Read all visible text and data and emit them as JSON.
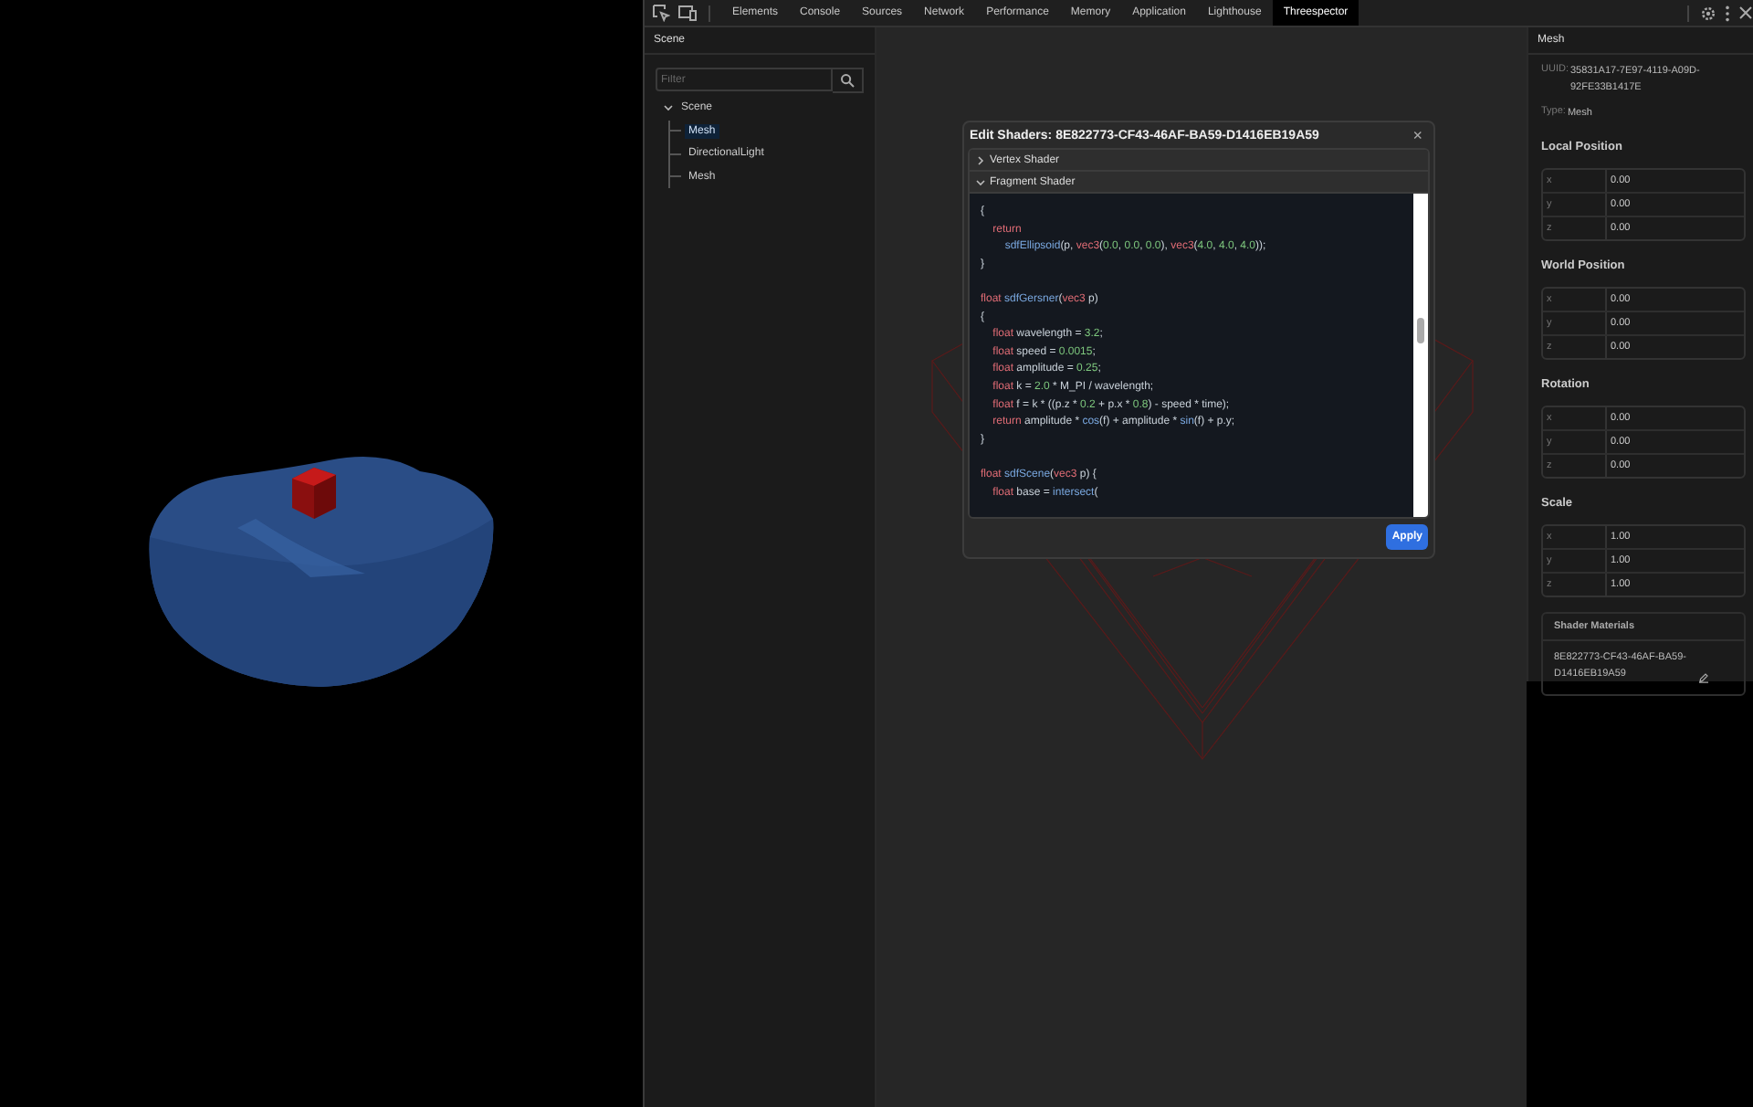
{
  "devtools": {
    "tabs": [
      {
        "label": "Elements",
        "selected": false
      },
      {
        "label": "Console",
        "selected": false
      },
      {
        "label": "Sources",
        "selected": false
      },
      {
        "label": "Network",
        "selected": false
      },
      {
        "label": "Performance",
        "selected": false
      },
      {
        "label": "Memory",
        "selected": false
      },
      {
        "label": "Application",
        "selected": false
      },
      {
        "label": "Lighthouse",
        "selected": false
      },
      {
        "label": "Threespector",
        "selected": true
      }
    ]
  },
  "scene_panel": {
    "title": "Scene",
    "filter": {
      "placeholder": "Filter"
    },
    "tree": [
      {
        "label": "Scene",
        "expanded": true,
        "selected": false,
        "children": [
          {
            "label": "Mesh",
            "selected": true
          },
          {
            "label": "DirectionalLight",
            "selected": false
          },
          {
            "label": "Mesh",
            "selected": false
          }
        ]
      }
    ]
  },
  "dialog": {
    "title": "Edit Shaders: 8E822773-CF43-46AF-BA59-D1416EB19A59",
    "close": "×",
    "sections": [
      {
        "label": "Vertex Shader",
        "expanded": false
      },
      {
        "label": "Fragment Shader",
        "expanded": true
      }
    ],
    "code": [
      {
        "kind": "code",
        "tokens": [
          {
            "text": "{",
            "kind": "plain"
          }
        ]
      },
      {
        "kind": "code",
        "tokens": [
          {
            "text": "    return",
            "kind": "kw"
          }
        ]
      },
      {
        "kind": "code",
        "tokens": [
          {
            "text": "        sdfEllipsoid",
            "kind": "fn"
          },
          {
            "text": "(p, ",
            "kind": "plain"
          },
          {
            "text": "vec3",
            "kind": "kw"
          },
          {
            "text": "(",
            "kind": "plain"
          },
          {
            "text": "0.0",
            "kind": "num"
          },
          {
            "text": ", ",
            "kind": "plain"
          },
          {
            "text": "0.0",
            "kind": "num"
          },
          {
            "text": ", ",
            "kind": "plain"
          },
          {
            "text": "0.0",
            "kind": "num"
          },
          {
            "text": "), ",
            "kind": "plain"
          },
          {
            "text": "vec3",
            "kind": "kw"
          },
          {
            "text": "(",
            "kind": "plain"
          },
          {
            "text": "4.0",
            "kind": "num"
          },
          {
            "text": ", ",
            "kind": "plain"
          },
          {
            "text": "4.0",
            "kind": "num"
          },
          {
            "text": ", ",
            "kind": "plain"
          },
          {
            "text": "4.0",
            "kind": "num"
          },
          {
            "text": "));",
            "kind": "plain"
          }
        ]
      },
      {
        "kind": "code",
        "tokens": [
          {
            "text": "}",
            "kind": "plain"
          }
        ]
      },
      {
        "kind": "blank"
      },
      {
        "kind": "code",
        "tokens": [
          {
            "text": "float",
            "kind": "kw"
          },
          {
            "text": " sdfGersner",
            "kind": "fn"
          },
          {
            "text": "(",
            "kind": "plain"
          },
          {
            "text": "vec3",
            "kind": "kw"
          },
          {
            "text": " p)",
            "kind": "plain"
          }
        ]
      },
      {
        "kind": "code",
        "tokens": [
          {
            "text": "{",
            "kind": "plain"
          }
        ]
      },
      {
        "kind": "code",
        "tokens": [
          {
            "text": "    float",
            "kind": "kw"
          },
          {
            "text": " wavelength = ",
            "kind": "plain"
          },
          {
            "text": "3.2",
            "kind": "num"
          },
          {
            "text": ";",
            "kind": "plain"
          }
        ]
      },
      {
        "kind": "code",
        "tokens": [
          {
            "text": "    float",
            "kind": "kw"
          },
          {
            "text": " speed = ",
            "kind": "plain"
          },
          {
            "text": "0.0015",
            "kind": "num"
          },
          {
            "text": ";",
            "kind": "plain"
          }
        ]
      },
      {
        "kind": "code",
        "tokens": [
          {
            "text": "    float",
            "kind": "kw"
          },
          {
            "text": " amplitude = ",
            "kind": "plain"
          },
          {
            "text": "0.25",
            "kind": "num"
          },
          {
            "text": ";",
            "kind": "plain"
          }
        ]
      },
      {
        "kind": "code",
        "tokens": [
          {
            "text": "    float",
            "kind": "kw"
          },
          {
            "text": " k = ",
            "kind": "plain"
          },
          {
            "text": "2.0",
            "kind": "num"
          },
          {
            "text": " * M_PI / wavelength;",
            "kind": "plain"
          }
        ]
      },
      {
        "kind": "code",
        "tokens": [
          {
            "text": "    float",
            "kind": "kw"
          },
          {
            "text": " f = k * ((p.z * ",
            "kind": "plain"
          },
          {
            "text": "0.2",
            "kind": "num"
          },
          {
            "text": " + p.x * ",
            "kind": "plain"
          },
          {
            "text": "0.8",
            "kind": "num"
          },
          {
            "text": ") - speed * time);",
            "kind": "plain"
          }
        ]
      },
      {
        "kind": "code",
        "tokens": [
          {
            "text": "    return",
            "kind": "kw"
          },
          {
            "text": " amplitude * ",
            "kind": "plain"
          },
          {
            "text": "cos",
            "kind": "fn"
          },
          {
            "text": "(f) + amplitude * ",
            "kind": "plain"
          },
          {
            "text": "sin",
            "kind": "fn"
          },
          {
            "text": "(f) + p.y;",
            "kind": "plain"
          }
        ]
      },
      {
        "kind": "code",
        "tokens": [
          {
            "text": "}",
            "kind": "plain"
          }
        ]
      },
      {
        "kind": "blank"
      },
      {
        "kind": "code",
        "tokens": [
          {
            "text": "float",
            "kind": "kw"
          },
          {
            "text": " sdfScene",
            "kind": "fn"
          },
          {
            "text": "(",
            "kind": "plain"
          },
          {
            "text": "vec3",
            "kind": "kw"
          },
          {
            "text": " p) {",
            "kind": "plain"
          }
        ]
      },
      {
        "kind": "code",
        "tokens": [
          {
            "text": "    float",
            "kind": "kw"
          },
          {
            "text": " base = ",
            "kind": "plain"
          },
          {
            "text": "intersect",
            "kind": "fn"
          },
          {
            "text": "(",
            "kind": "plain"
          }
        ]
      }
    ],
    "apply_button": "Apply"
  },
  "inspector": {
    "title": "Mesh",
    "uuid_label": "UUID:",
    "uuid": "35831A17-7E97-4119-A09D-92FE33B1417E",
    "type_label": "Type:",
    "type": "Mesh",
    "groups": [
      {
        "title": "Local Position",
        "rows": [
          {
            "axis": "x",
            "value": "0.00"
          },
          {
            "axis": "y",
            "value": "0.00"
          },
          {
            "axis": "z",
            "value": "0.00"
          }
        ]
      },
      {
        "title": "World Position",
        "rows": [
          {
            "axis": "x",
            "value": "0.00"
          },
          {
            "axis": "y",
            "value": "0.00"
          },
          {
            "axis": "z",
            "value": "0.00"
          }
        ]
      },
      {
        "title": "Rotation",
        "rows": [
          {
            "axis": "x",
            "value": "0.00"
          },
          {
            "axis": "y",
            "value": "0.00"
          },
          {
            "axis": "z",
            "value": "0.00"
          }
        ]
      },
      {
        "title": "Scale",
        "rows": [
          {
            "axis": "x",
            "value": "1.00"
          },
          {
            "axis": "y",
            "value": "1.00"
          },
          {
            "axis": "z",
            "value": "1.00"
          }
        ]
      }
    ],
    "materials": {
      "title": "Shader Materials",
      "item": "8E822773-CF43-46AF-BA59-D1416EB19A59"
    }
  }
}
